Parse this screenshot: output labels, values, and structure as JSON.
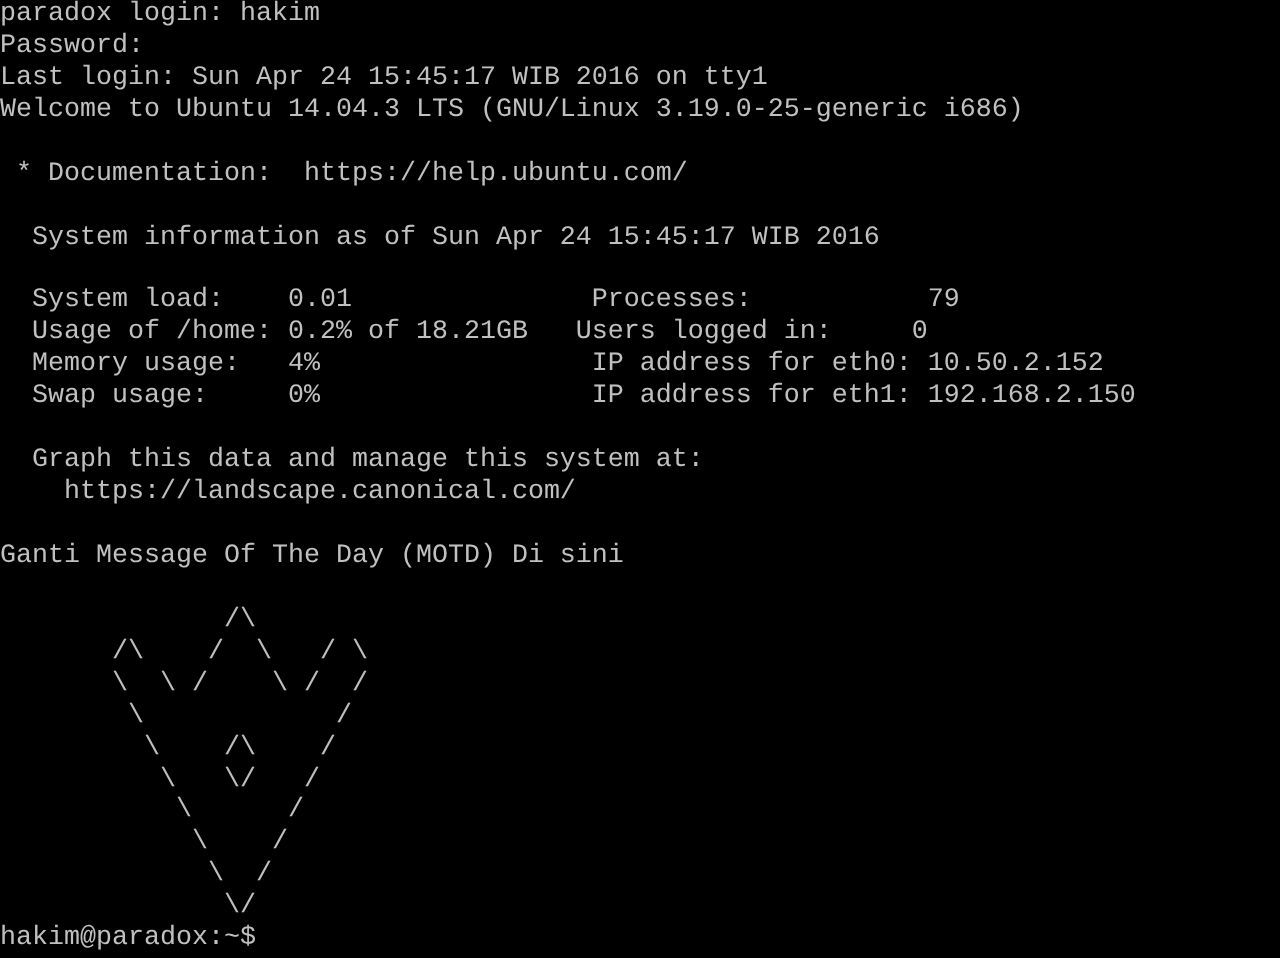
{
  "terminal": {
    "blocks": [
      {
        "lines": [
          "paradox login: hakim",
          "Password:",
          "Last login: Sun Apr 24 15:45:17 WIB 2016 on tty1",
          "Welcome to Ubuntu 14.04.3 LTS (GNU/Linux 3.19.0-25-generic i686)"
        ]
      },
      {
        "lines": [
          " * Documentation:  https://help.ubuntu.com/"
        ]
      },
      {
        "lines": [
          "  System information as of Sun Apr 24 15:45:17 WIB 2016"
        ]
      },
      {
        "lines": [
          "  System load:    0.01               Processes:           79",
          "  Usage of /home: 0.2% of 18.21GB   Users logged in:     0",
          "  Memory usage:   4%                 IP address for eth0: 10.50.2.152",
          "  Swap usage:     0%                 IP address for eth1: 192.168.2.150"
        ]
      },
      {
        "lines": [
          "  Graph this data and manage this system at:",
          "    https://landscape.canonical.com/"
        ]
      },
      {
        "lines": [
          "Ganti Message Of The Day (MOTD) Di sini"
        ]
      }
    ],
    "ascii_art": [
      "              /\\",
      "       /\\    /  \\   / \\",
      "       \\  \\ /    \\ /  /",
      "        \\            /",
      "         \\    /\\    /",
      "          \\   \\/   /",
      "           \\      /",
      "            \\    /",
      "             \\  /",
      "              \\/"
    ],
    "prompt": "hakim@paradox:~$"
  }
}
